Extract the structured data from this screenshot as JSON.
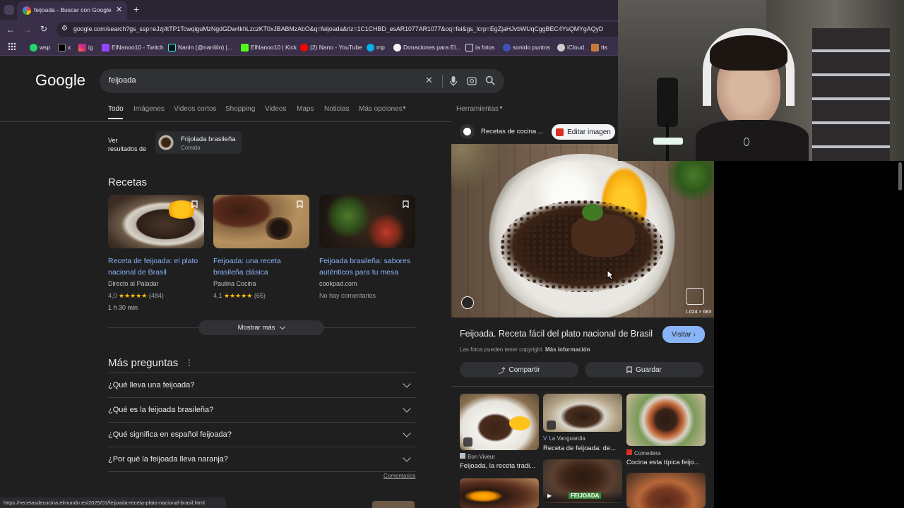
{
  "browser": {
    "tab_title": "feijoada - Buscar con Google",
    "url": "google.com/search?gs_ssp=eJzj4tTP1TcwqiguMzNgdGDw4khLzczKT0xJBABMzAbO&q=feijoada&rlz=1C1CHBD_esAR1077AR1077&oq=fei&gs_lcrp=EgZjaHJvbWUqCggBEC4YsQMYgAQyD",
    "bookmarks": [
      "wsp",
      "x",
      "ig",
      "ElNanoo10 - Twitch",
      "Nanin (@naniiiin) |...",
      "ElNanoo10 | Kick",
      "(2) Nano - YouTube",
      "mp",
      "Donaciones para El...",
      "ia fotos",
      "sonido puntos",
      "iCloud",
      "tts"
    ],
    "status_url": "https://recetasdecocina.elmundo.es/2025/01/feijoada-receta-plato-nacional-brasil.html"
  },
  "google": {
    "logo": "Google",
    "query": "feijoada",
    "tabs": [
      "Todo",
      "Imágenes",
      "Videos cortos",
      "Shopping",
      "Videos",
      "Maps",
      "Noticias",
      "Más opciones"
    ],
    "tools": "Herramientas",
    "see_results_line1": "Ver",
    "see_results_line2": "resultados de",
    "entity_title": "Frijolada brasileña",
    "entity_sub": "Comida",
    "recipes_heading": "Recetas",
    "recipes": [
      {
        "title": "Receta de feijoada: el plato nacional de Brasil",
        "source": "Directo al Paladar",
        "rating": "4,0",
        "stars": "★★★★★",
        "count": "(484)",
        "time": "1 h 30 min"
      },
      {
        "title": "Feijoada: una receta brasileña clásica",
        "source": "Paulina Cocina",
        "rating": "4,1",
        "stars": "★★★★★",
        "count": "(65)",
        "time": ""
      },
      {
        "title": "Feijoada brasileña: sabores auténticos para tu mesa",
        "source": "cookpad.com",
        "rating": "",
        "stars": "",
        "count": "",
        "time": "No hay comentarios"
      }
    ],
    "show_more": "Mostrar más",
    "paa_heading": "Más preguntas",
    "questions": [
      "¿Qué lleva una feijoada?",
      "¿Qué es la feijoada brasileña?",
      "¿Qué significa en español feijoada?",
      "¿Por qué la feijoada lleva naranja?"
    ],
    "comments": "Comentarios"
  },
  "panel": {
    "source": "Recetas de cocina ...",
    "edit_image": "Editar imagen",
    "dimensions": "1.024 × 683",
    "title": "Feijoada. Receta fácil del plato nacional de Brasil",
    "visit": "Visitar",
    "notice": "Las fotos pueden tener copyright.",
    "more_info": "Más información",
    "share": "Compartir",
    "save": "Guardar",
    "related": [
      {
        "source": "Bon Viveur",
        "title": "Feijoada, la receta tradi..."
      },
      {
        "source": "La Vanguardia",
        "title": "Receta de feijoada: de..."
      },
      {
        "source": "Comedera",
        "title": "Cocina esta típica feijo..."
      }
    ],
    "feijoada_badge": "FEIJOADA"
  },
  "colors": {
    "accent_blue": "#8ab4f8",
    "chrome_bar": "#3a2f48",
    "page_bg": "#1f1f1f"
  }
}
